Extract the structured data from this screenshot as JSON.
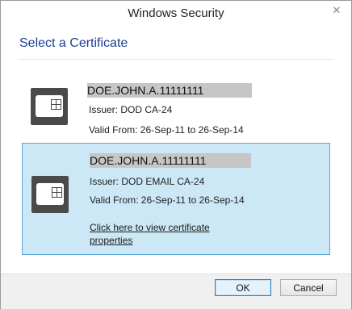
{
  "window": {
    "title": "Windows Security",
    "close_glyph": "✕"
  },
  "heading": "Select a Certificate",
  "certificates": [
    {
      "name": "DOE.JOHN.A.11111111",
      "issuer": "Issuer: DOD CA-24",
      "valid": "Valid From: 26-Sep-11 to 26-Sep-14",
      "icon": "smart-card-icon",
      "selected": false
    },
    {
      "name": "DOE.JOHN.A.11111111",
      "issuer": "Issuer: DOD EMAIL CA-24",
      "valid": "Valid From: 26-Sep-11 to 26-Sep-14",
      "icon": "smart-card-icon",
      "selected": true,
      "link": "Click here to view certificate properties"
    }
  ],
  "buttons": {
    "ok": "OK",
    "cancel": "Cancel"
  },
  "colors": {
    "heading": "#1c3f94",
    "selected_bg": "#cce8f7",
    "selected_border": "#5aa8d8"
  }
}
